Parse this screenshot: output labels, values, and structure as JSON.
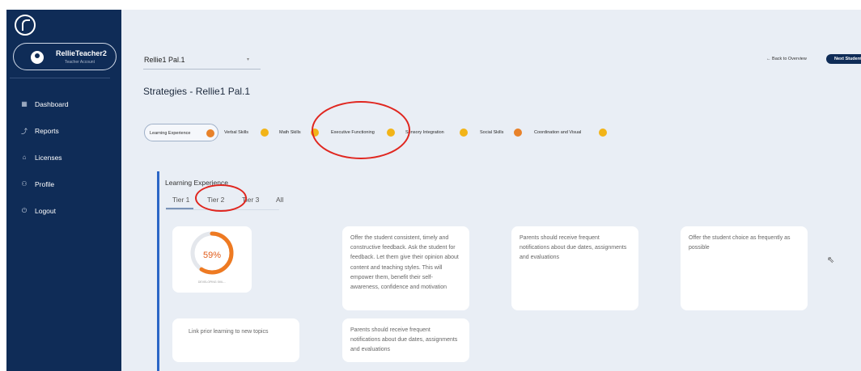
{
  "user": {
    "name": "RellieTeacher2",
    "role": "Teacher Account"
  },
  "nav": [
    {
      "label": "Dashboard",
      "icon": "dashboard-icon"
    },
    {
      "label": "Reports",
      "icon": "reports-icon"
    },
    {
      "label": "Licenses",
      "icon": "licenses-icon"
    },
    {
      "label": "Profile",
      "icon": "profile-icon"
    },
    {
      "label": "Logout",
      "icon": "logout-icon"
    }
  ],
  "student_select": {
    "value": "Rellie1 Pal.1"
  },
  "header": {
    "back_label": "Back to Overview",
    "next_label": "Next Student"
  },
  "page_title": "Strategies - Rellie1 Pal.1",
  "chips": [
    {
      "label": "Learning Experience",
      "color": "#e8822a"
    },
    {
      "label": "Verbal Skills",
      "color": "#f2b418"
    },
    {
      "label": "Math Skills",
      "color": "#f2b418"
    },
    {
      "label": "Executive Functioning",
      "color": "#f2b418"
    },
    {
      "label": "Sensory Integration",
      "color": "#f2b418"
    },
    {
      "label": "Social Skills",
      "color": "#e8822a"
    },
    {
      "label": "Coordination and Visual",
      "color": "#f2b418"
    }
  ],
  "section": {
    "title": "Learning Experience",
    "tabs": [
      "Tier 1",
      "Tier 2",
      "Tier 3",
      "All"
    ],
    "active_tab": "Tier 1"
  },
  "gauge": {
    "value": 0.59,
    "value_label": "59%",
    "label": "DEVELOPING SKIL..."
  },
  "cards": [
    "Offer the student consistent, timely and constructive feedback. Ask the student for feedback. Let them give their opinion about content and teaching styles. This will empower them, benefit their self-awareness, confidence and motivation",
    "Parents should receive frequent notifications about due dates, assignments and evaluations",
    "Offer the student choice as frequently as possible",
    "Link prior learning to new topics",
    "Parents should receive frequent notifications about due dates, assignments and evaluations"
  ]
}
